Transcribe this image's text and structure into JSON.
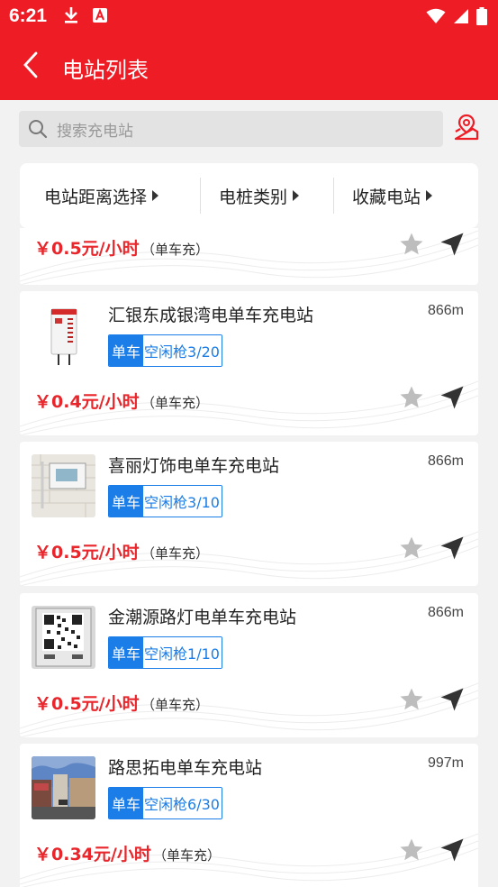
{
  "status_bar": {
    "time": "6:21",
    "icons_left": [
      "download-icon",
      "font-a-icon"
    ],
    "icons_right": [
      "wifi-icon",
      "signal-icon",
      "battery-icon"
    ]
  },
  "app_bar": {
    "title": "电站列表",
    "back_icon": "back-arrow-icon",
    "background": "#ee1c25"
  },
  "search": {
    "placeholder": "搜索充电站",
    "map_icon": "map-location-icon"
  },
  "filters": [
    {
      "label": "电站距离选择"
    },
    {
      "label": "电桩类别"
    },
    {
      "label": "收藏电站"
    }
  ],
  "colors": {
    "brand_red": "#ee1c25",
    "price_red": "#e8262b",
    "tag_blue": "#1a7de8"
  },
  "partial_card": {
    "price": "￥0.5元/小时",
    "note": "（单车充）"
  },
  "stations": [
    {
      "name": "汇银东成银湾电单车充电站",
      "distance": "866m",
      "tag_type": "单车",
      "free_label": "空闲枪3/20",
      "price": "￥0.4元/小时",
      "note": "（单车充）",
      "thumb": "charging-box-photo"
    },
    {
      "name": "喜丽灯饰电单车充电站",
      "distance": "866m",
      "tag_type": "单车",
      "free_label": "空闲枪3/10",
      "price": "￥0.5元/小时",
      "note": "（单车充）",
      "thumb": "wall-box-photo"
    },
    {
      "name": "金潮源路灯电单车充电站",
      "distance": "866m",
      "tag_type": "单车",
      "free_label": "空闲枪1/10",
      "price": "￥0.5元/小时",
      "note": "（单车充）",
      "thumb": "qr-code-photo"
    },
    {
      "name": "路思拓电单车充电站",
      "distance": "997m",
      "tag_type": "单车",
      "free_label": "空闲枪6/30",
      "price": "￥0.34元/小时",
      "note": "（单车充）",
      "thumb": "street-photo"
    }
  ]
}
